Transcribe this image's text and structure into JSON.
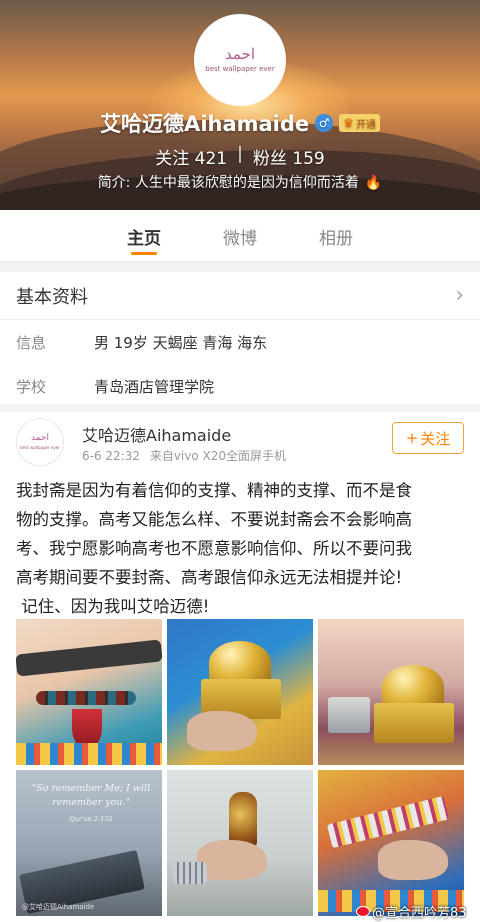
{
  "profile": {
    "avatar_arabic": "احمد",
    "avatar_subtitle": "best wallpaper ever",
    "name": "艾哈迈德Aihamaide",
    "gender_symbol": "♂",
    "vip_label": "开通",
    "following_label": "关注",
    "following_count": "421",
    "separator": "|",
    "followers_label": "粉丝",
    "followers_count": "159",
    "bio": "简介: 人生中最该欣慰的是因为信仰而活着"
  },
  "tabs": [
    {
      "label": "主页",
      "active": true
    },
    {
      "label": "微博",
      "active": false
    },
    {
      "label": "相册",
      "active": false
    }
  ],
  "basic_info": {
    "title": "基本资料",
    "rows": [
      {
        "key": "信息",
        "value": "男  19岁  天蝎座  青海 海东"
      },
      {
        "key": "学校",
        "value": "青岛酒店管理学院"
      }
    ]
  },
  "post": {
    "author": "艾哈迈德Aihamaide",
    "time": "6-6 22:32",
    "source": "来自vivo X20全面屏手机",
    "follow_label": "关注",
    "text_lines": [
      "我封斋是因为有着信仰的支撑、精神的支撑、而不是食",
      "物的支撑。高考又能怎么样、不要说封斋会不会影响高",
      "考、我宁愿影响高考也不愿意影响信仰、所以不要问我",
      "高考期间要不要封斋、高考跟信仰永远无法相提并论!",
      " 记住、因为我叫艾哈迈德!"
    ],
    "photo4_quote": "\"So remember Me; I will remember you.\"",
    "photo4_ref": "Qur'an 2:152",
    "photo4_watermark": "@艾哈迈德Aihamaide"
  },
  "watermark": "@宣合西吟芳83"
}
